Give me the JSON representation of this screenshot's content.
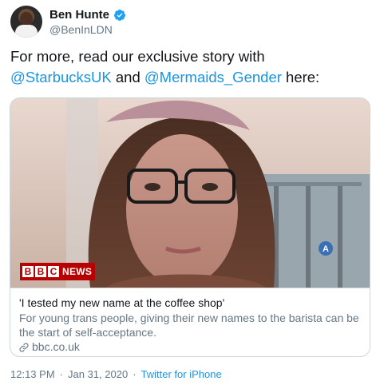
{
  "author": {
    "display_name": "Ben Hunte",
    "handle": "@BenInLDN",
    "verified": true
  },
  "tweet": {
    "text_prefix": "For more, read our exclusive story with ",
    "mention_1": "@StarbucksUK",
    "text_mid": " and ",
    "mention_2": "@Mermaids_Gender",
    "text_suffix": " here:"
  },
  "card": {
    "badge_letters": [
      "B",
      "B",
      "C"
    ],
    "badge_word": "NEWS",
    "title": "'I tested my new name at the coffee shop'",
    "description": "For young trans people, giving their new names to the barista can be the start of self-acceptance.",
    "domain": "bbc.co.uk"
  },
  "meta": {
    "time": "12:13 PM",
    "separator": "·",
    "date": "Jan 31, 2020",
    "separator_2": "·",
    "source": "Twitter for iPhone"
  },
  "colors": {
    "link": "#1b95e0",
    "secondary_text": "#657786",
    "bbc_red": "#b80000"
  }
}
